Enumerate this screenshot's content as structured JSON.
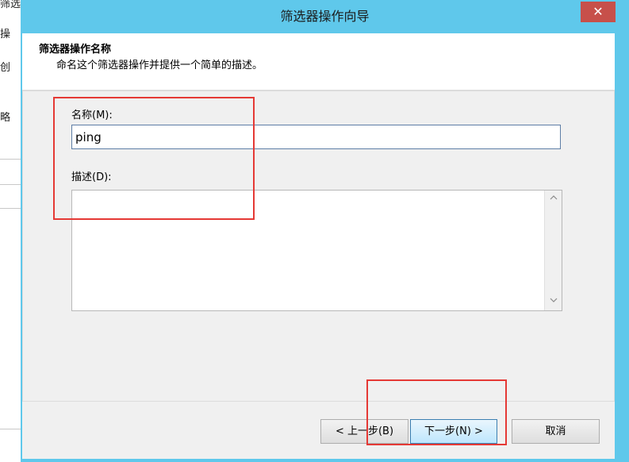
{
  "background_window": {
    "fragments": [
      "筛选器操作",
      "操",
      "创",
      "略",
      ""
    ]
  },
  "dialog": {
    "title": "筛选器操作向导",
    "close_label": "✕",
    "header": {
      "title": "筛选器操作名称",
      "subtitle": "命名这个筛选器操作并提供一个简单的描述。"
    },
    "form": {
      "name_label": "名称(M):",
      "name_value": "ping",
      "description_label": "描述(D):",
      "description_value": ""
    },
    "scrollbar": {
      "up_icon": "chevron-up-icon",
      "down_icon": "chevron-down-icon"
    },
    "buttons": {
      "back": "< 上一步(B)",
      "next": "下一步(N) >",
      "cancel": "取消"
    }
  },
  "colors": {
    "titlebar": "#5fc8eb",
    "close": "#c7504a",
    "highlight_box": "#e53935"
  }
}
